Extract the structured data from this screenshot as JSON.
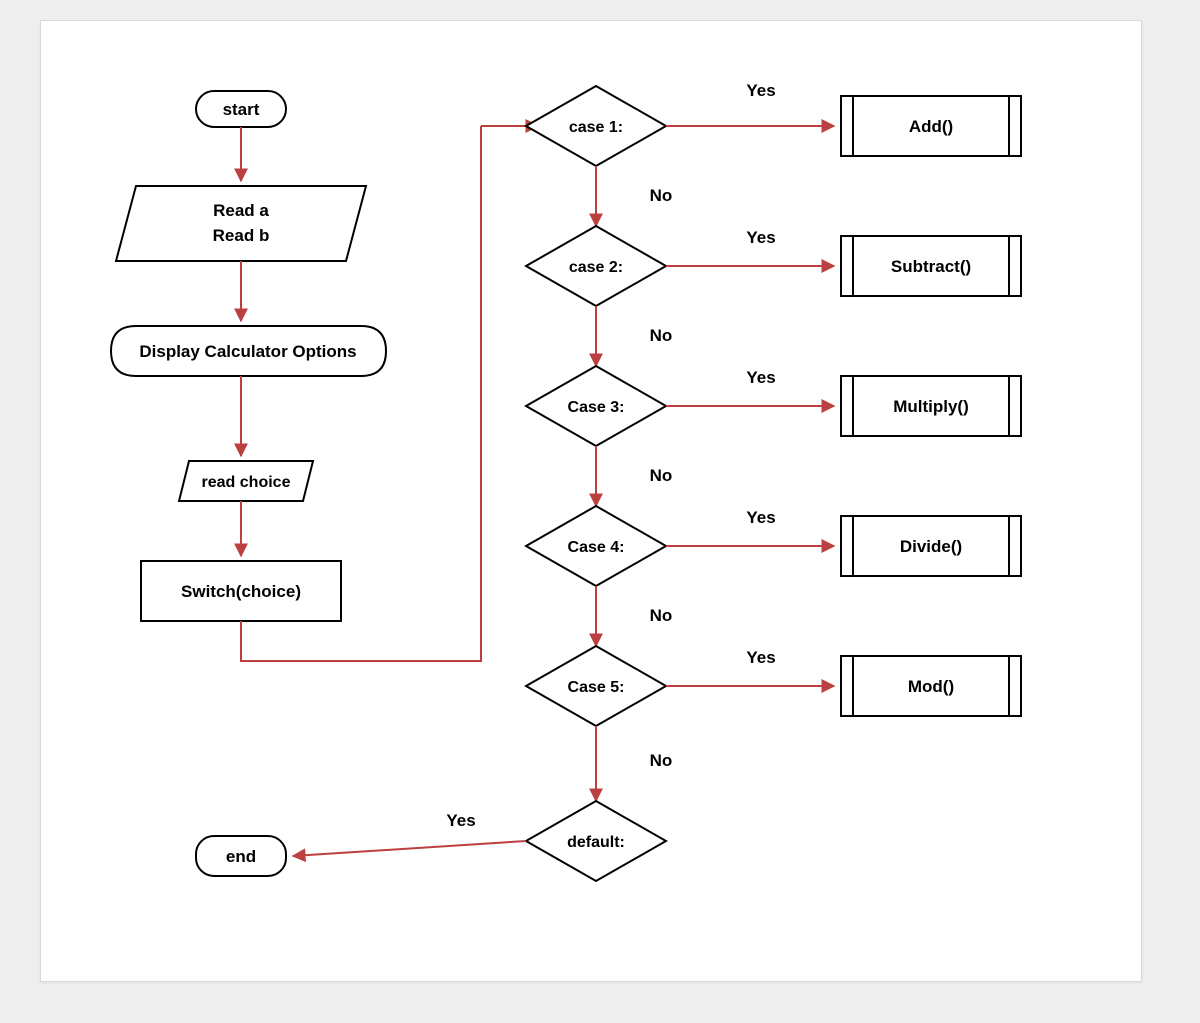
{
  "nodes": {
    "start": "start",
    "end": "end",
    "read_ab_line1": "Read a",
    "read_ab_line2": "Read b",
    "display_options": "Display Calculator Options",
    "read_choice": "read choice",
    "switch": "Switch(choice)",
    "case1": "case 1:",
    "case2": "case 2:",
    "case3": "Case 3:",
    "case4": "Case 4:",
    "case5": "Case 5:",
    "default": "default:",
    "add": "Add()",
    "subtract": "Subtract()",
    "multiply": "Multiply()",
    "divide": "Divide()",
    "mod": "Mod()"
  },
  "labels": {
    "yes": "Yes",
    "no": "No"
  }
}
